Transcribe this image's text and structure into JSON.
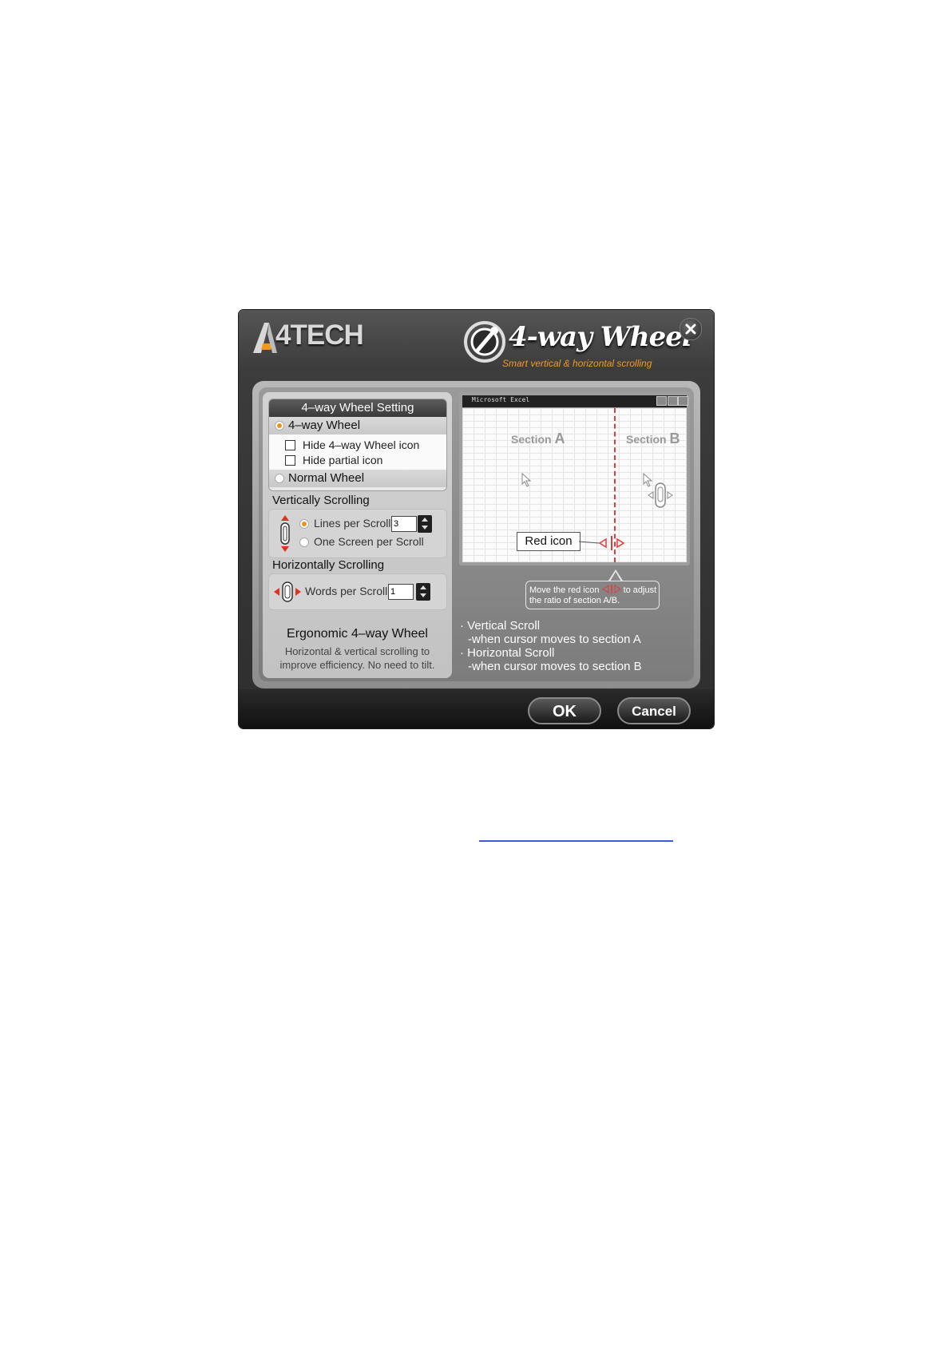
{
  "dialog": {
    "brand": "4TECH",
    "product_title": "4-way Wheel",
    "product_tagline": "Smart vertical & horizontal scrolling",
    "close_icon": "close-icon",
    "settings": {
      "group_title": "4–way Wheel Setting",
      "option_4way": "4–way Wheel",
      "hide_4way_icon": "Hide 4–way Wheel icon",
      "hide_partial_icon": "Hide partial icon",
      "option_normal": "Normal Wheel",
      "selected_mode": "4-way Wheel"
    },
    "vertical": {
      "title": "Vertically Scrolling",
      "lines_label": "Lines per Scroll:",
      "lines_value": "3",
      "screen_label": "One Screen per Scroll",
      "selected": "lines"
    },
    "horizontal": {
      "title": "Horizontally Scrolling",
      "words_label": "Words per Scroll:",
      "words_value": "1"
    },
    "ergo": {
      "title": "Ergonomic 4–way Wheel",
      "desc": "Horizontal & vertical scrolling to improve efficiency. No need to tilt."
    },
    "preview": {
      "window_title": "Microsoft Excel",
      "section_a": "Section",
      "section_a_letter": "A",
      "section_b": "Section",
      "section_b_letter": "B",
      "red_icon_label": "Red icon"
    },
    "tip": {
      "line1_pre": "Move the red icon",
      "line1_post": "to adjust",
      "line2": "the ratio of section A/B."
    },
    "bullets": {
      "b1": "· Vertical Scroll",
      "b1_sub": "-when cursor moves to section A",
      "b2": "· Horizontal Scroll",
      "b2_sub": "-when cursor moves to section B"
    },
    "buttons": {
      "ok": "OK",
      "cancel": "Cancel"
    },
    "colors": {
      "accent_orange": "#f39a1e",
      "red_icon": "#e23a3a",
      "link_blue": "#3b5bdb"
    }
  }
}
